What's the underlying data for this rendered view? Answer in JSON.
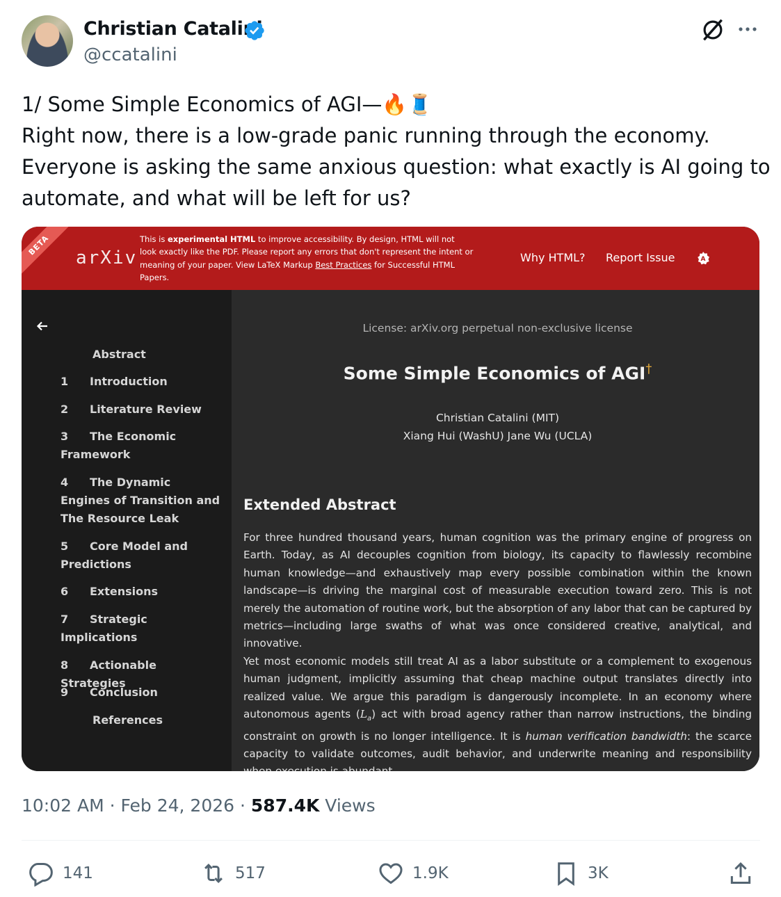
{
  "author": {
    "name": "Christian Catalini",
    "handle": "@ccatalini"
  },
  "tweet": {
    "lines": [
      "1/ Some Simple Economics of AGI—🔥🧵",
      "Right now, there is a low-grade panic running through the economy.",
      "Everyone is asking the same anxious question: what exactly is AI going to",
      "automate, and what will be left for us?"
    ]
  },
  "arxiv": {
    "beta": "BETA",
    "logo": "arXiv",
    "banner": {
      "pre": "This is ",
      "bold": "experimental HTML",
      "mid": " to improve accessibility. By design, HTML will not look exactly like the PDF. Please report any errors that don't represent the intent or meaning of your paper. View LaTeX Markup ",
      "link": "Best Practices",
      "post": " for Successful HTML Papers."
    },
    "why_html": "Why HTML?",
    "report_issue": "Report Issue",
    "toc": [
      {
        "num": "",
        "label": "Abstract"
      },
      {
        "num": "1",
        "label": "Introduction"
      },
      {
        "num": "2",
        "label": "Literature Review"
      },
      {
        "num": "3",
        "label": "The Economic Framework"
      },
      {
        "num": "4",
        "label": "The Dynamic Engines of Transition and The Resource Leak"
      },
      {
        "num": "5",
        "label": "Core Model and Predictions"
      },
      {
        "num": "6",
        "label": "Extensions"
      },
      {
        "num": "7",
        "label": "Strategic Implications"
      },
      {
        "num": "8",
        "label": "Actionable Strategies"
      },
      {
        "num": "9",
        "label": "Conclusion"
      },
      {
        "num": "",
        "label": "References"
      }
    ],
    "license": "License: arXiv.org perpetual non-exclusive license",
    "title": "Some Simple Economics of AGI",
    "title_mark": "†",
    "authors_line1": "Christian Catalini (MIT)",
    "authors_line2": "Xiang Hui (WashU) Jane Wu (UCLA)",
    "section": "Extended Abstract",
    "para1": "For three hundred thousand years, human cognition was the primary engine of progress on Earth. Today, as AI decouples cognition from biology, its capacity to flawlessly recombine human knowledge—and exhaustively map every possible combination within the known landscape—is driving the marginal cost of measurable execution toward zero. This is not merely the automation of routine work, but the absorption of any labor that can be captured by metrics—including large swaths of what was once considered creative, analytical, and innovative.",
    "para2_a": "Yet most economic models still treat AI as a labor substitute or a complement to exogenous human judgment, implicitly assuming that cheap machine output translates directly into realized value. We argue this paradigm is dangerously incomplete. In an economy where autonomous agents (",
    "para2_math": "L",
    "para2_sub": "a",
    "para2_b": ") act with broad agency rather than narrow instructions, the binding constraint on growth is no longer intelligence. It is ",
    "para2_em": "human verification bandwidth",
    "para2_c": ": the scarce capacity to validate outcomes, audit behavior, and underwrite meaning and responsibility when execution is abundant."
  },
  "meta": {
    "time": "10:02 AM",
    "sep1": " · ",
    "date": "Feb 24, 2026",
    "sep2": " · ",
    "views_count": "587.4K",
    "views_label": " Views"
  },
  "actions": {
    "replies": "141",
    "reposts": "517",
    "likes": "1.9K",
    "bookmarks": "3K"
  },
  "colors": {
    "arxiv_red": "#b31b1b",
    "verified_blue": "#1d9bf0",
    "muted": "#536471"
  }
}
